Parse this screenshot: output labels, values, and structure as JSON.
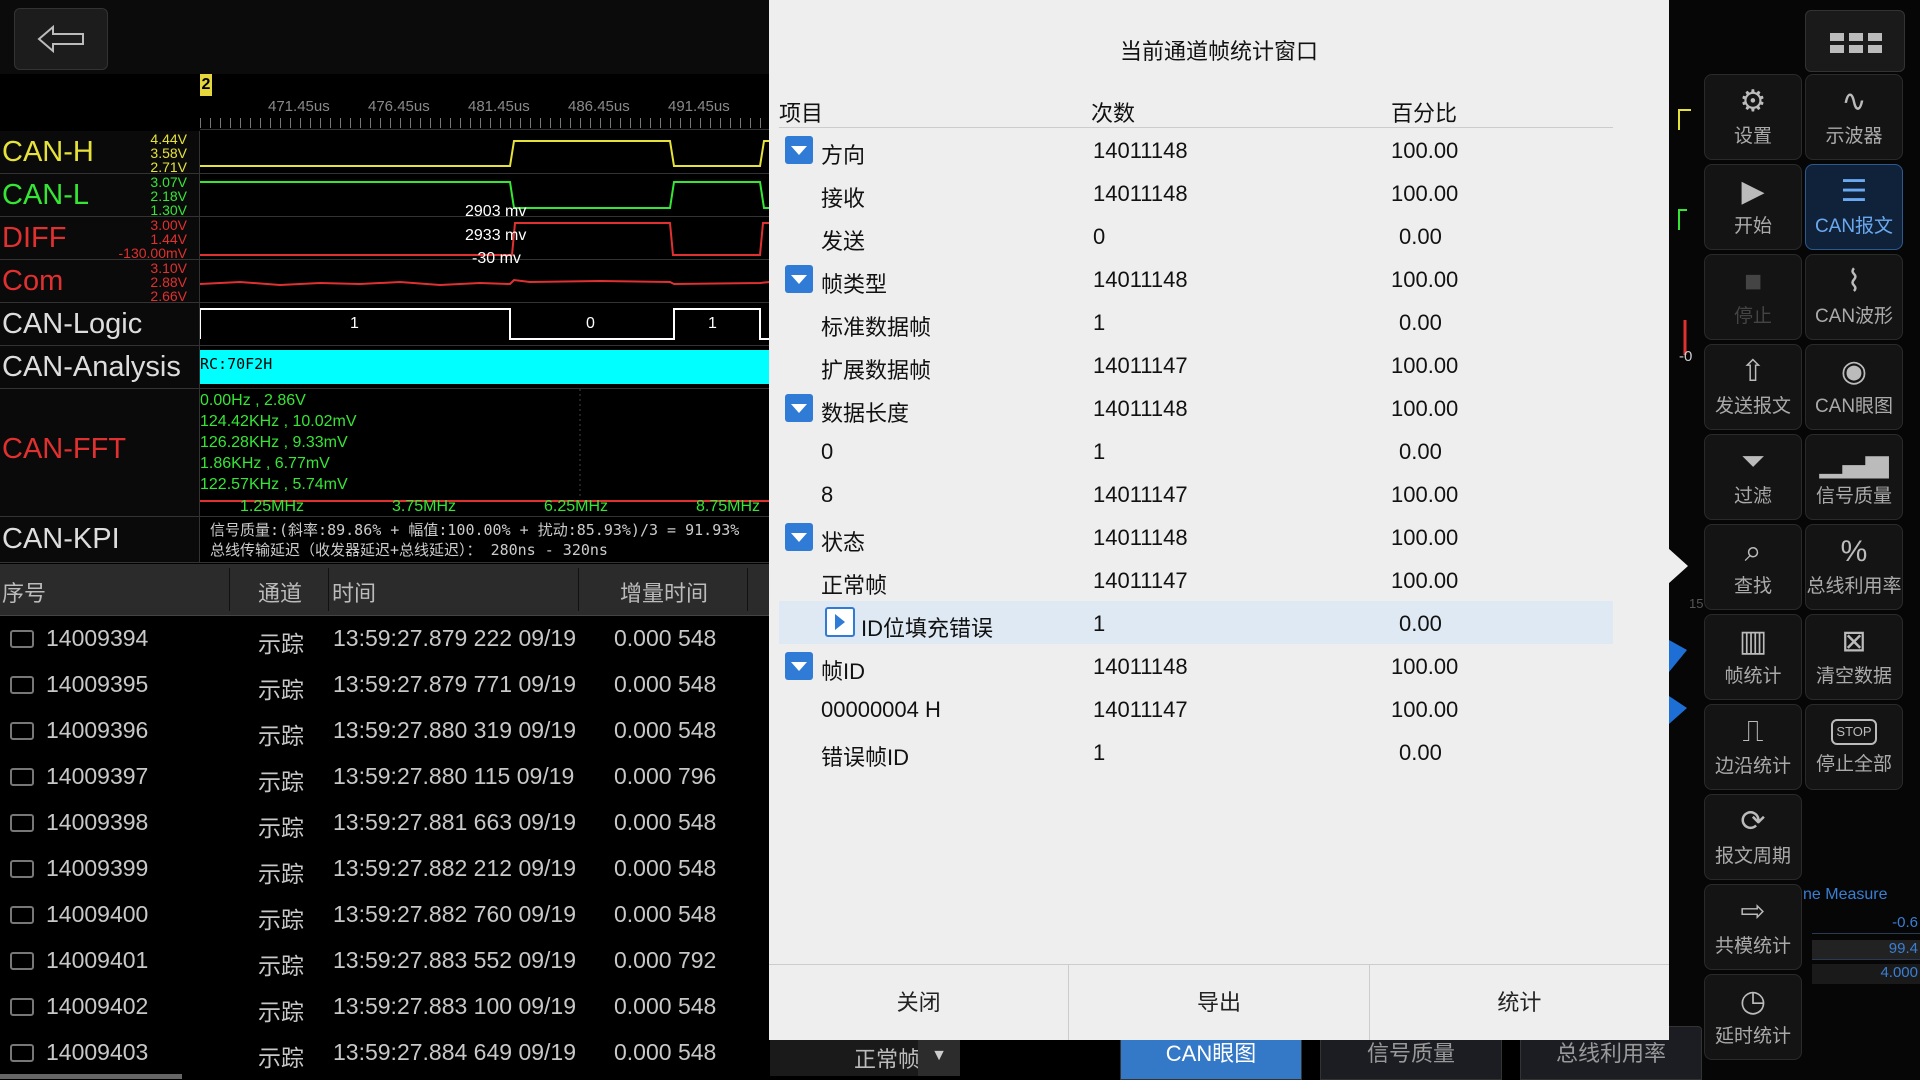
{
  "ruler": {
    "marker": "2",
    "labels": [
      "471.45us",
      "476.45us",
      "481.45us",
      "486.45us",
      "491.45us"
    ]
  },
  "channels": [
    {
      "name": "CAN-H",
      "color": "#e6e23a",
      "volts": [
        "4.44V",
        "3.58V",
        "2.71V"
      ]
    },
    {
      "name": "CAN-L",
      "color": "#35e635",
      "volts": [
        "3.07V",
        "2.18V",
        "1.30V"
      ]
    },
    {
      "name": "DIFF",
      "color": "#e03030",
      "volts": [
        "3.00V",
        "1.44V",
        "-130.00mV"
      ]
    },
    {
      "name": "Com",
      "color": "#e03030",
      "volts": [
        "3.10V",
        "2.88V",
        "2.66V"
      ]
    },
    {
      "name": "CAN-Logic",
      "color": "#dddddd"
    },
    {
      "name": "CAN-Analysis",
      "color": "#dddddd"
    },
    {
      "name": "CAN-FFT",
      "color": "#e03030"
    },
    {
      "name": "CAN-KPI",
      "color": "#dddddd"
    }
  ],
  "diff_annotations": [
    "2903 mv",
    "2933 mv",
    "-30 mv"
  ],
  "logic_bits": [
    "1",
    "0",
    "1"
  ],
  "analysis_text": "RC:70F2H",
  "fft": {
    "lines": [
      "0.00Hz , 2.86V",
      "124.42KHz , 10.02mV",
      "126.28KHz , 9.33mV",
      "1.86KHz , 6.77mV",
      "122.57KHz , 5.74mV"
    ],
    "freqs": [
      "1.25MHz",
      "3.75MHz",
      "6.25MHz",
      "8.75MHz"
    ]
  },
  "kpi": {
    "line1": "信号质量:(斜率:89.86% + 幅值:100.00% + 扰动:85.93%)/3 = 91.93%",
    "line2": "总线传输延迟（收发器延迟+总线延迟）：  280ns - 320ns"
  },
  "msg_table": {
    "headers": [
      "序号",
      "通道",
      "时间",
      "增量时间"
    ],
    "rows": [
      {
        "seq": "14009394",
        "ch": "示踪",
        "time": "13:59:27.879 222 09/19",
        "delta": "0.000 548"
      },
      {
        "seq": "14009395",
        "ch": "示踪",
        "time": "13:59:27.879 771 09/19",
        "delta": "0.000 548"
      },
      {
        "seq": "14009396",
        "ch": "示踪",
        "time": "13:59:27.880 319 09/19",
        "delta": "0.000 548"
      },
      {
        "seq": "14009397",
        "ch": "示踪",
        "time": "13:59:27.880 115 09/19",
        "delta": "0.000 796"
      },
      {
        "seq": "14009398",
        "ch": "示踪",
        "time": "13:59:27.881 663 09/19",
        "delta": "0.000 548"
      },
      {
        "seq": "14009399",
        "ch": "示踪",
        "time": "13:59:27.882 212 09/19",
        "delta": "0.000 548"
      },
      {
        "seq": "14009400",
        "ch": "示踪",
        "time": "13:59:27.882 760 09/19",
        "delta": "0.000 548"
      },
      {
        "seq": "14009401",
        "ch": "示踪",
        "time": "13:59:27.883 552 09/19",
        "delta": "0.000 792"
      },
      {
        "seq": "14009402",
        "ch": "示踪",
        "time": "13:59:27.883 100 09/19",
        "delta": "0.000 548"
      },
      {
        "seq": "14009403",
        "ch": "示踪",
        "time": "13:59:27.884 649 09/19",
        "delta": "0.000 548"
      }
    ]
  },
  "bottom_filter": "正常帧",
  "dialog": {
    "title": "当前通道帧统计窗口",
    "headers": [
      "项目",
      "次数",
      "百分比"
    ],
    "rows": [
      {
        "label": "方向",
        "count": "14011148",
        "pct": "100.00",
        "type": "group"
      },
      {
        "label": "接收",
        "count": "14011148",
        "pct": "100.00",
        "type": "child"
      },
      {
        "label": "发送",
        "count": "0",
        "pct": "0.00",
        "type": "child"
      },
      {
        "label": "帧类型",
        "count": "14011148",
        "pct": "100.00",
        "type": "group"
      },
      {
        "label": "标准数据帧",
        "count": "1",
        "pct": "0.00",
        "type": "child"
      },
      {
        "label": "扩展数据帧",
        "count": "14011147",
        "pct": "100.00",
        "type": "child"
      },
      {
        "label": "数据长度",
        "count": "14011148",
        "pct": "100.00",
        "type": "group"
      },
      {
        "label": "0",
        "count": "1",
        "pct": "0.00",
        "type": "child"
      },
      {
        "label": "8",
        "count": "14011147",
        "pct": "100.00",
        "type": "child"
      },
      {
        "label": "状态",
        "count": "14011148",
        "pct": "100.00",
        "type": "group"
      },
      {
        "label": "正常帧",
        "count": "14011147",
        "pct": "100.00",
        "type": "child"
      },
      {
        "label": "ID位填充错误",
        "count": "1",
        "pct": "0.00",
        "type": "subgroup"
      },
      {
        "label": "帧ID",
        "count": "14011148",
        "pct": "100.00",
        "type": "group"
      },
      {
        "label": "00000004 H",
        "count": "14011147",
        "pct": "100.00",
        "type": "child"
      },
      {
        "label": "错误帧ID",
        "count": "1",
        "pct": "0.00",
        "type": "child"
      }
    ],
    "buttons": [
      "关闭",
      "导出",
      "统计"
    ]
  },
  "tools_left": [
    {
      "label": "设置",
      "icon": "gear-icon",
      "glyph": "⚙"
    },
    {
      "label": "开始",
      "icon": "play-icon",
      "glyph": "▶"
    },
    {
      "label": "停止",
      "icon": "stop-icon",
      "glyph": "■"
    },
    {
      "label": "发送报文",
      "icon": "upload-icon",
      "glyph": "⇧"
    },
    {
      "label": "过滤",
      "icon": "filter-icon",
      "glyph": "⏷"
    },
    {
      "label": "查找",
      "icon": "search-icon",
      "glyph": "⌕"
    },
    {
      "label": "帧统计",
      "icon": "frame-stats-icon",
      "glyph": "▥"
    },
    {
      "label": "边沿统计",
      "icon": "edge-stats-icon",
      "glyph": "⎍"
    },
    {
      "label": "报文周期",
      "icon": "cycle-icon",
      "glyph": "⟳"
    },
    {
      "label": "共模统计",
      "icon": "fft-icon",
      "glyph": "⇨"
    },
    {
      "label": "延时统计",
      "icon": "clock-icon",
      "glyph": "◷"
    }
  ],
  "tools_right": [
    {
      "label": "示波器",
      "icon": "oscilloscope-icon",
      "glyph": "∿"
    },
    {
      "label": "CAN报文",
      "icon": "message-list-icon",
      "glyph": "☰"
    },
    {
      "label": "CAN波形",
      "icon": "waveform-icon",
      "glyph": "⌇"
    },
    {
      "label": "CAN眼图",
      "icon": "eye-icon",
      "glyph": "◉"
    },
    {
      "label": "信号质量",
      "icon": "signal-bars-icon",
      "glyph": "▁▃▅"
    },
    {
      "label": "总线利用率",
      "icon": "bus-usage-icon",
      "glyph": "%"
    },
    {
      "label": "清空数据",
      "icon": "clear-icon",
      "glyph": "⊠"
    },
    {
      "label": "停止全部",
      "icon": "stop-all-icon",
      "glyph": "STOP"
    }
  ],
  "measure": {
    "label": "ne Measure",
    "values": [
      "-0.6",
      "99.4",
      "4.000"
    ]
  },
  "bottom_tabs": [
    "CAN眼图",
    "信号质量",
    "总线利用率"
  ]
}
